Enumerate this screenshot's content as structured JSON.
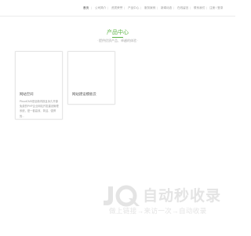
{
  "nav": {
    "items": [
      {
        "label": "首页",
        "active": true
      },
      {
        "label": "公司简介",
        "active": false
      },
      {
        "label": "资质荣誉",
        "active": false
      },
      {
        "label": "产品中心",
        "active": false
      },
      {
        "label": "服务案例",
        "active": false
      },
      {
        "label": "新闻动态",
        "active": false
      },
      {
        "label": "在线留言",
        "active": false
      },
      {
        "label": "联系我们",
        "active": false
      },
      {
        "label": "注册 / 登录",
        "active": false
      }
    ]
  },
  "section": {
    "title": "产品中心",
    "subtitle": "· 提供优质产品、卓越的体验 ·"
  },
  "cards": [
    {
      "title": "网站空间",
      "description": "PbootCMS是全新内核且永久开源免费的PHP企业网站开发建设管理系统，是一套高效、简洁、强悍的..."
    },
    {
      "title": "网站建设模板云"
    }
  ],
  "watermark": {
    "logo_text": "JQ",
    "main_text": "自动秒收录",
    "sub_text": "做上链接→来访一次→自动收录"
  },
  "colors": {
    "accent": "#5fb447",
    "watermark": "#e4e4e4"
  }
}
